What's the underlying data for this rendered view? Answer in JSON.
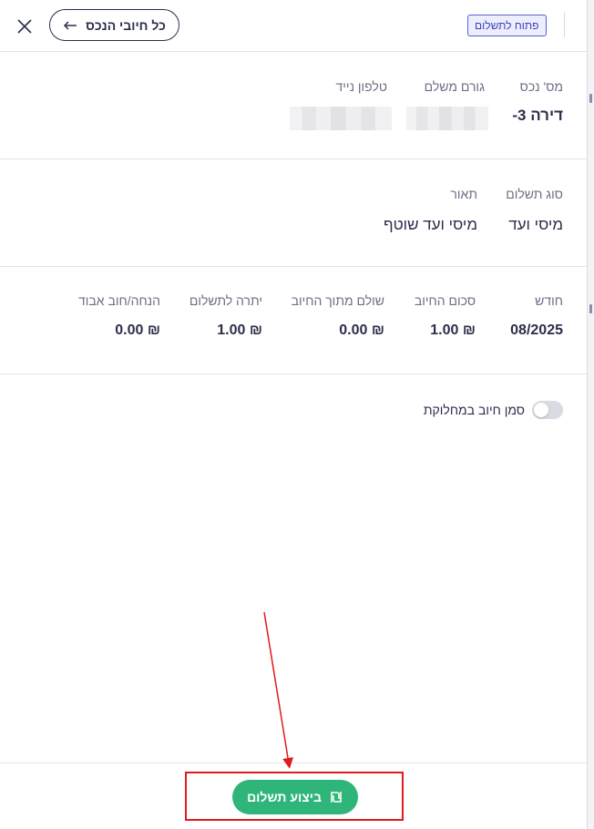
{
  "header": {
    "back_button_label": "כל חיובי הנכס",
    "status_badge": "פתוח לתשלום"
  },
  "property": {
    "number_label": "מס' נכס",
    "number_value": "דירה 3-",
    "payer_label": "גורם משלם",
    "phone_label": "טלפון נייד"
  },
  "payment": {
    "type_label": "סוג תשלום",
    "type_value": "מיסי ועד",
    "description_label": "תאור",
    "description_value": "מיסי ועד שוטף"
  },
  "charge": {
    "month_label": "חודש",
    "month_value": "08/2025",
    "amount_label": "סכום החיוב",
    "amount_value": "₪ 1.00",
    "paid_label": "שולם מתוך החיוב",
    "paid_value": "₪ 0.00",
    "balance_label": "יתרה לתשלום",
    "balance_value": "₪ 1.00",
    "discount_label": "הנחה/חוב אבוד",
    "discount_value": "₪ 0.00"
  },
  "dispute": {
    "label": "סמן חיוב במחלוקת",
    "enabled": false
  },
  "footer": {
    "pay_button_label": "ביצוע תשלום"
  },
  "colors": {
    "accent_green": "#2fb57a",
    "badge_border": "#5b5fd6",
    "annotation_red": "#e01b1b",
    "text_dark": "#2b2e4a"
  },
  "icons": {
    "close": "close-icon",
    "back": "arrow-left-icon",
    "pay": "shekel-icon"
  }
}
